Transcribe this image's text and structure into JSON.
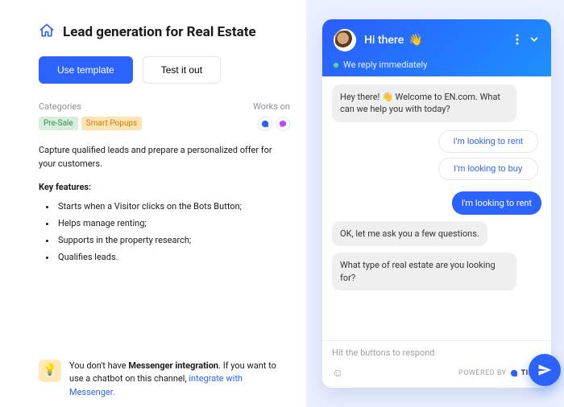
{
  "header": {
    "title": "Lead generation for Real Estate"
  },
  "buttons": {
    "use_template": "Use template",
    "test_it_out": "Test it out"
  },
  "meta": {
    "categories_label": "Categories",
    "works_on_label": "Works on",
    "tags": [
      "Pre-Sale",
      "Smart Popups"
    ]
  },
  "description": "Capture qualified leads and prepare a personalized offer for your customers.",
  "key_features_title": "Key features:",
  "features": [
    "Starts when a Visitor clicks on the Bots Button;",
    "Helps manage renting;",
    "Supports in the property research;",
    "Qualifies leads."
  ],
  "tip": {
    "prefix": "You don't have ",
    "bold": "Messenger integration",
    "mid": ". If you want to use a chatbot on this channel, ",
    "link": "integrate with Messenger.",
    "link_trailing": ""
  },
  "chat": {
    "greeting": "Hi there",
    "subtitle": "We reply immediately",
    "bot1": "Hey there! 👋 Welcome to EN.com. What can we help you with today?",
    "options": [
      "I'm looking to rent",
      "I'm looking to buy"
    ],
    "user_choice": "I'm looking to rent",
    "bot2": "OK, let me ask you a few questions.",
    "bot3": "What type of real estate are you looking for?",
    "input_placeholder": "Hit the buttons to respond",
    "powered_label": "POWERED BY",
    "brand": "TIDIO"
  }
}
